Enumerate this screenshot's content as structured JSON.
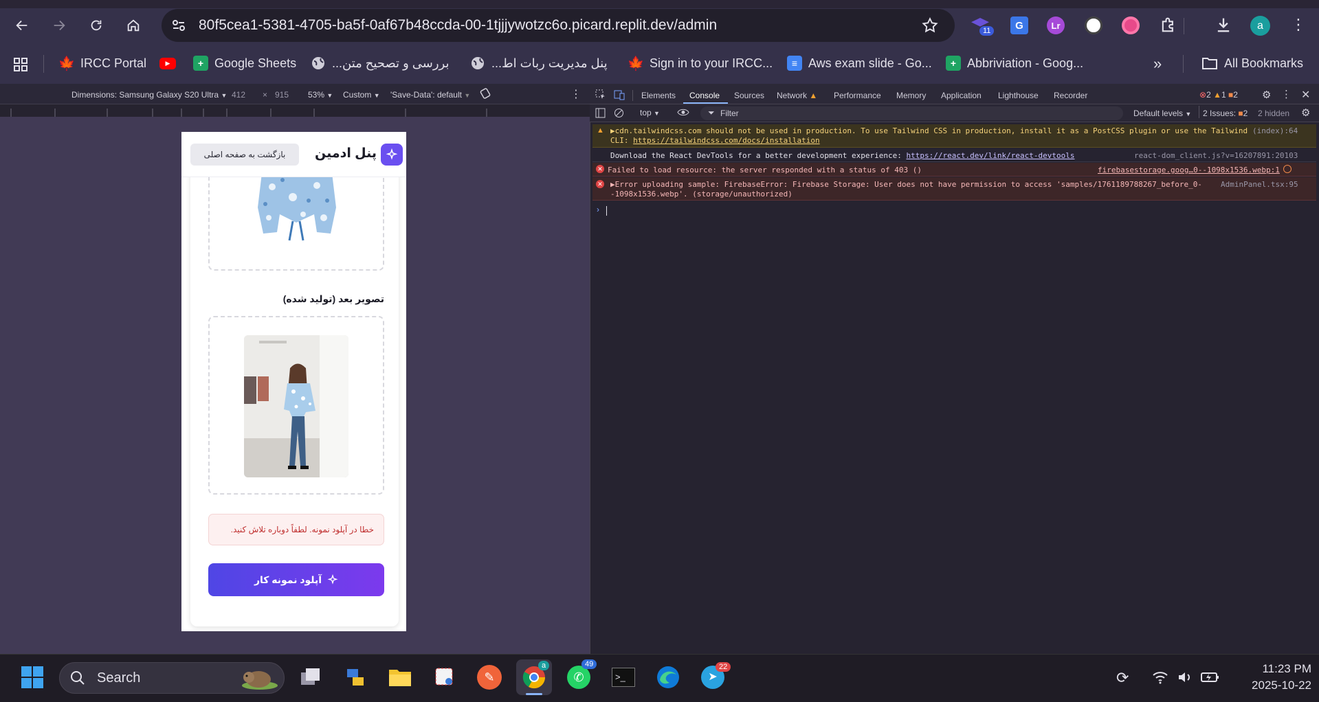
{
  "browser": {
    "url": "80f5cea1-5381-4705-ba5f-0af67b48ccda-00-1tjjjywotzc6o.picard.replit.dev/admin",
    "profile_initial": "a",
    "extension_badge": "11"
  },
  "bookmarks": [
    {
      "label": "IRCC Portal",
      "icon": "maple-leaf-icon",
      "color": "#d52b1e"
    },
    {
      "label": "",
      "icon": "youtube-icon",
      "color": "#ff0000"
    },
    {
      "label": "Google Sheets",
      "icon": "sheets-icon",
      "color": "#1fa463"
    },
    {
      "label": "بررسی و تصحیح متن...",
      "icon": "globe-icon",
      "color": "#cfcdd8"
    },
    {
      "label": "پنل مدیریت ربات اط...",
      "icon": "globe-icon",
      "color": "#cfcdd8"
    },
    {
      "label": "Sign in to your IRCC...",
      "icon": "maple-leaf-icon",
      "color": "#d52b1e"
    },
    {
      "label": "Aws exam slide - Go...",
      "icon": "docs-icon",
      "color": "#4285f4"
    },
    {
      "label": "Abbriviation - Goog...",
      "icon": "sheets-icon",
      "color": "#1fa463"
    }
  ],
  "all_bookmarks": "All Bookmarks",
  "emulation": {
    "dimensions": "Dimensions: Samsung Galaxy S20 Ultra",
    "width": "412",
    "height": "915",
    "zoom": "53%",
    "throttle": "Custom",
    "save_data": "'Save-Data': default"
  },
  "app": {
    "title": "پنل ادمین",
    "back_button": "بازگشت به صفحه اصلی",
    "after_label": "تصویر بعد (تولید شده)",
    "error_text": "خطا در آپلود نمونه. لطفاً دوباره تلاش کنید.",
    "upload_button": "آپلود نمونه کار"
  },
  "devtools": {
    "tabs": [
      "Elements",
      "Console",
      "Sources",
      "Network",
      "Performance",
      "Memory",
      "Application",
      "Lighthouse",
      "Recorder"
    ],
    "active_tab": "Console",
    "counts": {
      "errors": "2",
      "warnings": "1",
      "info": "2"
    },
    "context": "top",
    "filter_placeholder": "Filter",
    "levels": "Default levels",
    "issues": "2 Issues:",
    "issues_count": "2",
    "hidden": "2 hidden",
    "messages": [
      {
        "level": "warning",
        "text": "▶cdn.tailwindcss.com should not be used in production. To use Tailwind CSS in production, install it as a PostCSS plugin or use the Tailwind",
        "text2": "CLI: ",
        "link2": "https://tailwindcss.com/docs/installation",
        "source": "(index):64"
      },
      {
        "level": "info",
        "text": "Download the React DevTools for a better development experience: ",
        "link": "https://react.dev/link/react-devtools",
        "source": "react-dom_client.js?v=16207891:20103"
      },
      {
        "level": "error",
        "text": "Failed to load resource: the server responded with a status of 403 ()",
        "source": "firebasestorage.goog…0--1098x1536.webp:1"
      },
      {
        "level": "error",
        "text": "▶Error uploading sample: FirebaseError: Firebase Storage: User does not have permission to access 'samples/1761189788267_before_0-",
        "text2": "-1098x1536.webp'. (storage/unauthorized)",
        "source": "AdminPanel.tsx:95"
      }
    ]
  },
  "taskbar": {
    "search": "Search",
    "time": "11:23 PM",
    "date": "2025-10-22",
    "whatsapp_badge": "49",
    "telegram_badge": "22",
    "chrome_badge": "a"
  },
  "colors": {
    "accent": "#5b4ef0",
    "accent2": "#7b3ff2",
    "error_bg": "#fdf0f0",
    "error_text": "#c03030"
  }
}
